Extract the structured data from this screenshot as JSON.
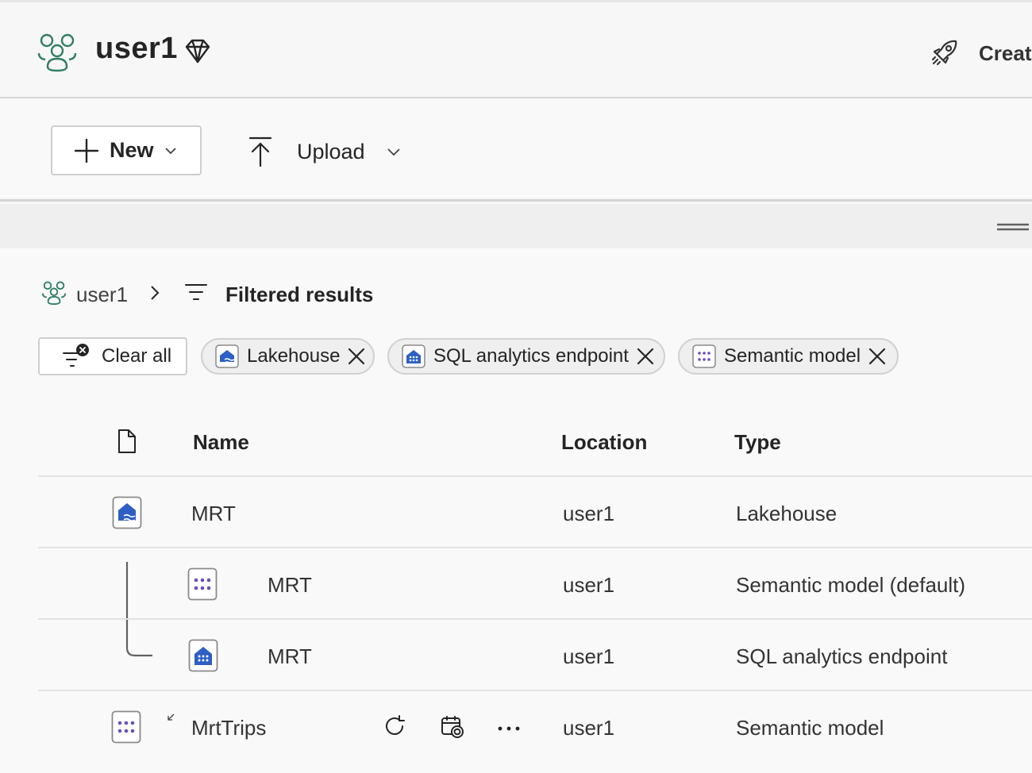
{
  "header": {
    "workspace_title": "user1",
    "create_label": "Creat"
  },
  "toolbar": {
    "new_label": "New",
    "upload_label": "Upload"
  },
  "breadcrumb": {
    "workspace": "user1",
    "current": "Filtered results"
  },
  "filters": {
    "clear_all_label": "Clear all",
    "chips": [
      {
        "label": "Lakehouse",
        "icon": "lakehouse-icon"
      },
      {
        "label": "SQL analytics endpoint",
        "icon": "sql-endpoint-icon"
      },
      {
        "label": "Semantic model",
        "icon": "semantic-model-icon"
      }
    ]
  },
  "table": {
    "columns": {
      "name": "Name",
      "location": "Location",
      "type": "Type"
    },
    "rows": [
      {
        "name": "MRT",
        "location": "user1",
        "type": "Lakehouse",
        "icon": "lakehouse-icon"
      },
      {
        "name": "MRT",
        "location": "user1",
        "type": "Semantic model (default)",
        "icon": "semantic-model-icon"
      },
      {
        "name": "MRT",
        "location": "user1",
        "type": "SQL analytics endpoint",
        "icon": "sql-endpoint-icon"
      },
      {
        "name": "MrtTrips",
        "location": "user1",
        "type": "Semantic model",
        "icon": "semantic-model-icon"
      }
    ]
  },
  "colors": {
    "workspace_green": "#2f7d63",
    "fabric_blue": "#2d5fc4",
    "semantic_purple": "#6b4fbb"
  }
}
